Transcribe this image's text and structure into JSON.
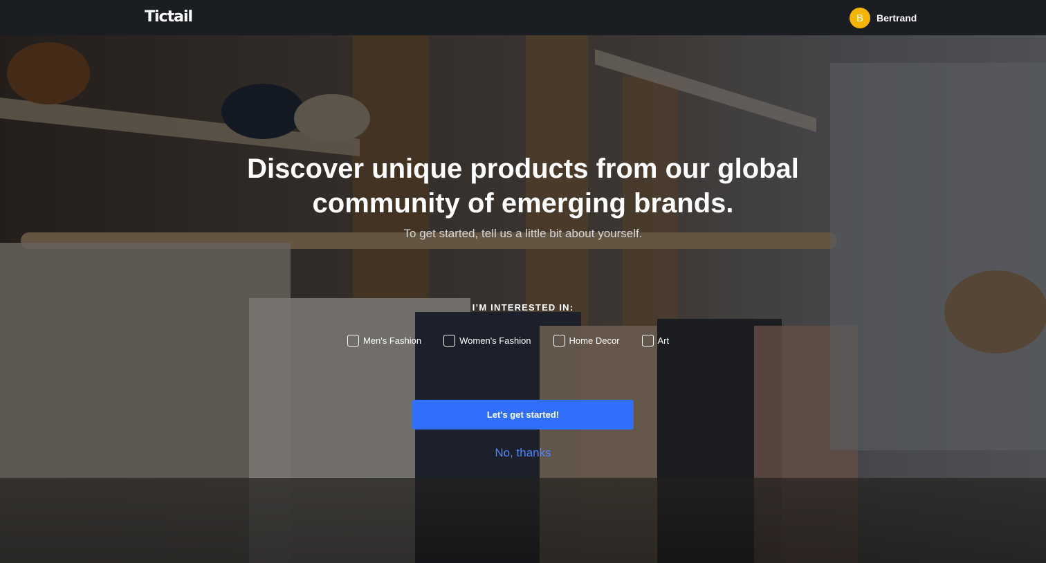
{
  "header": {
    "logo": "Tictail",
    "user": {
      "initial": "B",
      "name": "Bertrand"
    }
  },
  "hero": {
    "headline_line1": "Discover unique products from our global",
    "headline_line2": "community of emerging brands.",
    "subhead": "To get started, tell us a little bit about yourself.",
    "interest_label": "I’M INTERESTED IN:",
    "options": [
      {
        "label": "Men's Fashion",
        "checked": false
      },
      {
        "label": "Women's Fashion",
        "checked": false
      },
      {
        "label": "Home Decor",
        "checked": false
      },
      {
        "label": "Art",
        "checked": false
      }
    ],
    "cta_label": "Let's get started!",
    "decline_label": "No, thanks"
  },
  "colors": {
    "topbar": "#1a1d22",
    "avatar": "#f5b400",
    "cta": "#2f6ffb",
    "link": "#4b86ff"
  }
}
